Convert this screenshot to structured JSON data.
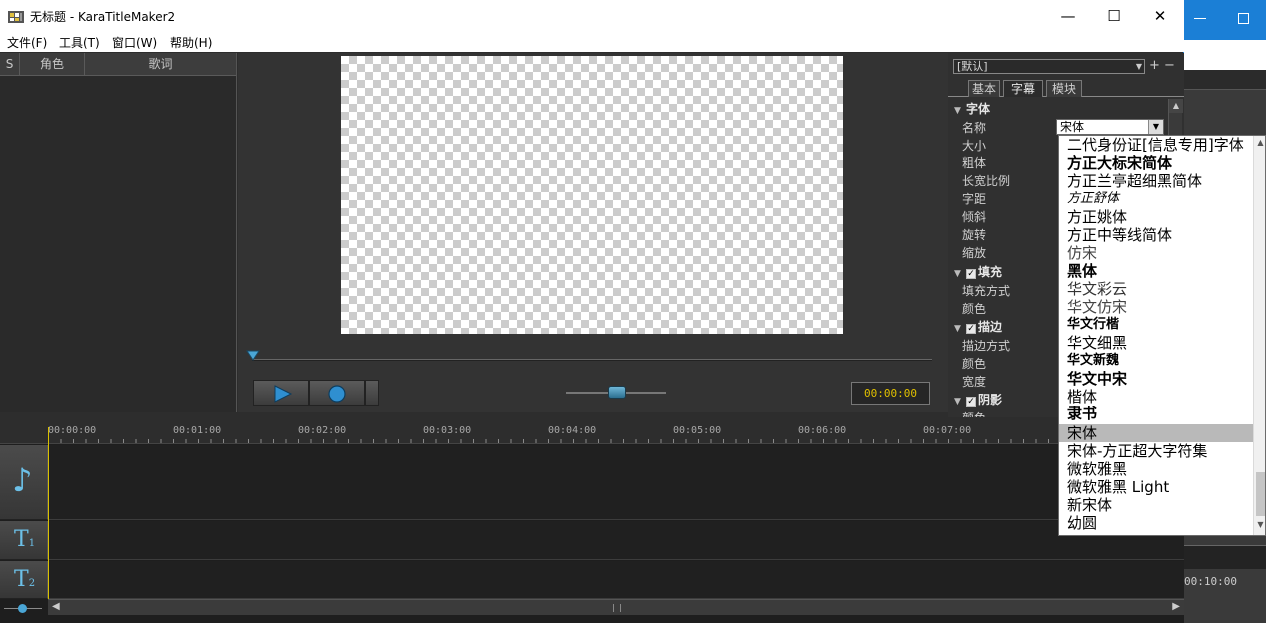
{
  "window": {
    "title": "无标题 - KaraTitleMaker2",
    "controls": {
      "minimize": "—",
      "maximize": "☐",
      "close": "✕"
    }
  },
  "menu": [
    "文件(F)",
    "工具(T)",
    "窗口(W)",
    "帮助(H)"
  ],
  "lyrics_panel": {
    "columns": [
      "S",
      "角色",
      "歌词"
    ]
  },
  "preview": {
    "timecode": "00:00:00"
  },
  "properties": {
    "preset": "[默认]",
    "preset_add": "+",
    "preset_remove": "−",
    "tabs": [
      "基本",
      "字幕",
      "模块"
    ],
    "active_tab": "字幕",
    "groups": {
      "font": "字体",
      "fill": "填充",
      "stroke": "描边",
      "shadow": "阴影"
    },
    "font_rows": [
      "名称",
      "大小",
      "粗体",
      "长宽比例",
      "字距",
      "倾斜",
      "旋转",
      "缩放"
    ],
    "fill_rows": [
      "填充方式",
      "颜色"
    ],
    "stroke_rows": [
      "描边方式",
      "颜色",
      "宽度"
    ],
    "shadow_rows": [
      "颜色"
    ],
    "font_name_value": "宋体"
  },
  "timeline": {
    "ticks": [
      "00:00:00",
      "00:01:00",
      "00:02:00",
      "00:03:00",
      "00:04:00",
      "00:05:00",
      "00:06:00",
      "00:07:00"
    ],
    "tracks": [
      {
        "icon": "music-note-icon",
        "glyph": "♪"
      },
      {
        "icon": "text-track-1-icon",
        "glyph": "T",
        "sub": "1"
      },
      {
        "icon": "text-track-2-icon",
        "glyph": "T",
        "sub": "2"
      }
    ]
  },
  "font_dropdown": {
    "options": [
      "二代身份证[信息专用]字体",
      "方正大标宋简体",
      "方正兰亭超细黑简体",
      "方正舒体",
      "方正姚体",
      "方正中等线简体",
      "仿宋",
      "黑体",
      "华文彩云",
      "华文仿宋",
      "华文行楷",
      "华文细黑",
      "华文新魏",
      "华文中宋",
      "楷体",
      "隶书",
      "宋体",
      "宋体-方正超大字符集",
      "微软雅黑",
      "微软雅黑 Light",
      "新宋体",
      "幼圆"
    ],
    "selected": "宋体"
  },
  "background_window": {
    "timecode": "00:10:00"
  }
}
